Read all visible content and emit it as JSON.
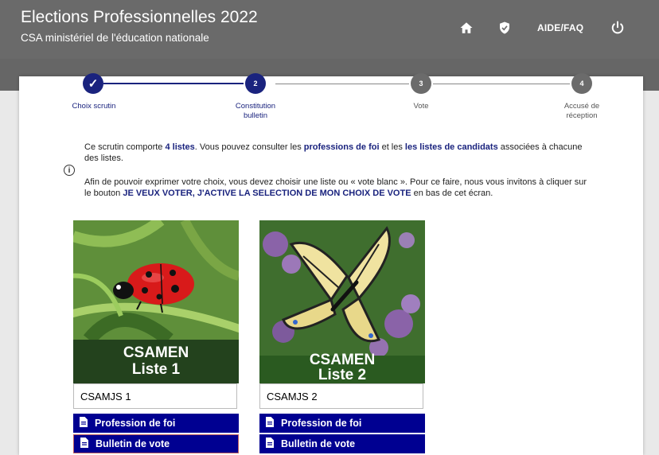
{
  "header": {
    "title": "Elections Professionnelles 2022",
    "subtitle": "CSA ministériel de l'éducation nationale",
    "aide": "AIDE/FAQ"
  },
  "stepper": {
    "steps": [
      {
        "number": "✓",
        "label": "Choix scrutin",
        "state": "done"
      },
      {
        "number": "2",
        "label": "Constitution bulletin",
        "state": "active"
      },
      {
        "number": "3",
        "label": "Vote",
        "state": "todo"
      },
      {
        "number": "4",
        "label": "Accusé de réception",
        "state": "todo"
      }
    ]
  },
  "info": {
    "p1_a": "Ce scrutin comporte ",
    "p1_b": "4 listes",
    "p1_c": ". Vous pouvez consulter les ",
    "p1_d": "professions de foi",
    "p1_e": " et les ",
    "p1_f": "les listes de candidats",
    "p1_g": " associées à chacune des listes.",
    "p2_a": "Afin de pouvoir exprimer votre choix, vous devez choisir une liste ou « vote blanc ». Pour ce faire, nous vous invitons à cliquer sur le bouton ",
    "p2_b": "JE VEUX VOTER, J'ACTIVE LA SELECTION DE MON CHOIX DE VOTE",
    "p2_c": " en bas de cet écran."
  },
  "lists": [
    {
      "image_line1": "CSAMEN",
      "image_line2": "Liste 1",
      "name": "CSAMJS 1",
      "btn1": "Profession de foi",
      "btn2": "Bulletin de vote"
    },
    {
      "image_line1": "CSAMEN",
      "image_line2": "Liste 2",
      "name": "CSAMJS 2",
      "btn1": "Profession de foi",
      "btn2": "Bulletin de vote"
    }
  ],
  "colors": {
    "accent": "#000091",
    "header": "#6a6a6a",
    "done": "#1a237e",
    "todo": "#6b6b6b"
  }
}
